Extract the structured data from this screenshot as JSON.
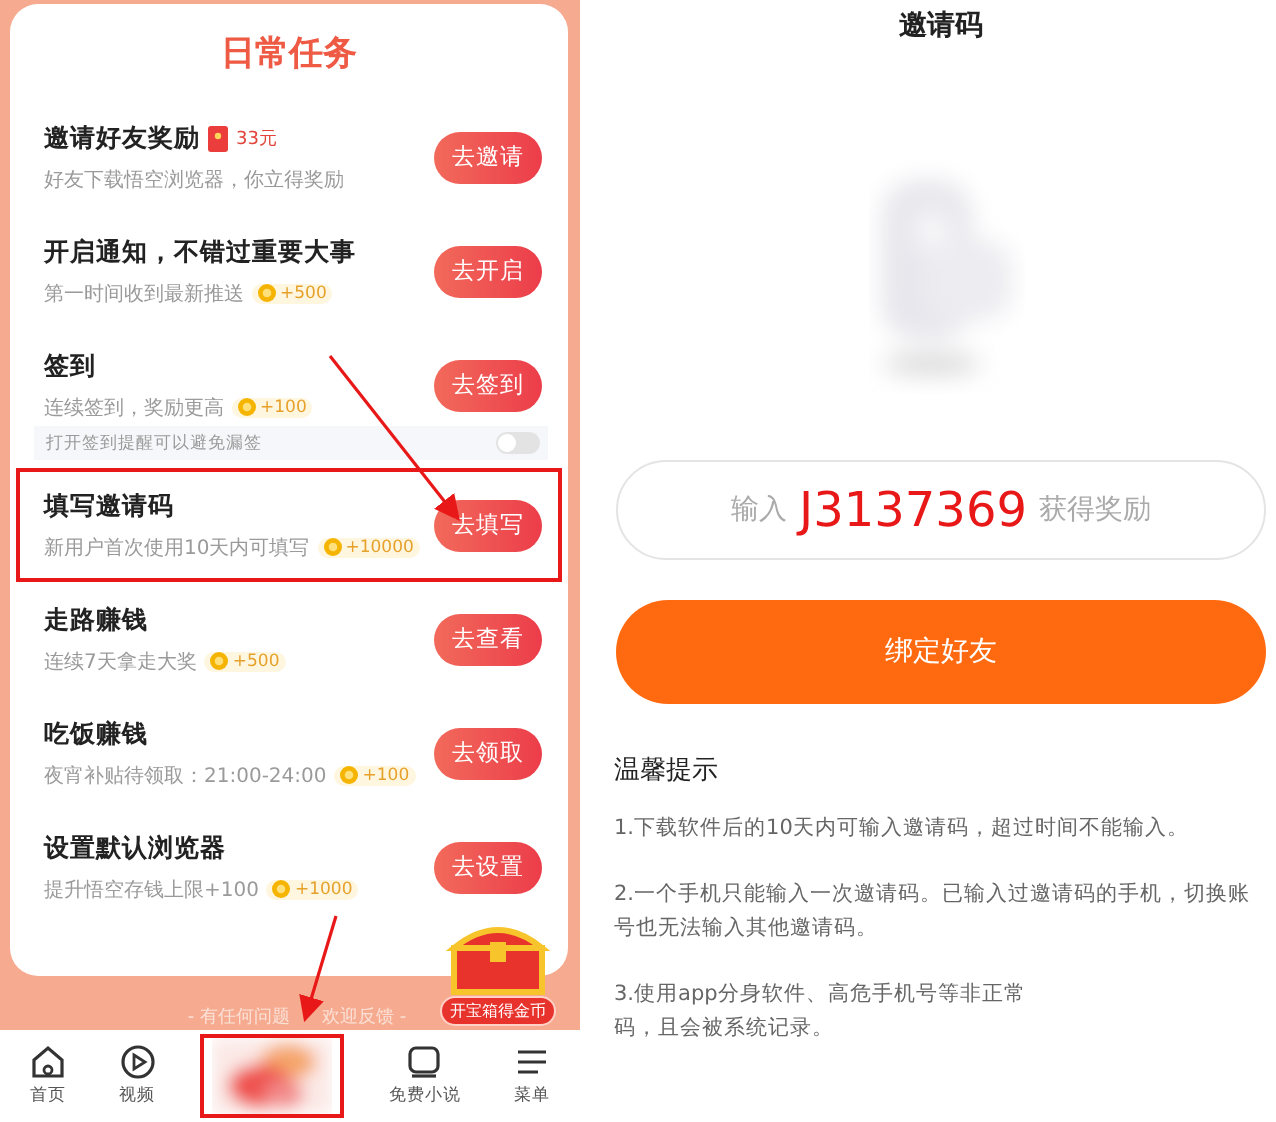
{
  "task_panel": {
    "title": "日常任务",
    "tasks": [
      {
        "title": "邀请好友奖励",
        "badge": {
          "kind": "cash",
          "text": "33元"
        },
        "subtitle": "好友下载悟空浏览器，你立得奖励",
        "button": "去邀请",
        "highlighted": false
      },
      {
        "title": "开启通知，不错过重要大事",
        "subtitle": "第一时间收到最新推送",
        "badge": {
          "kind": "coins",
          "text": "+500"
        },
        "button": "去开启",
        "highlighted": false
      },
      {
        "title": "签到",
        "subtitle": "连续签到，奖励更高",
        "badge": {
          "kind": "coins",
          "text": "+100"
        },
        "button": "去签到",
        "highlighted": false,
        "reminder": {
          "label": "打开签到提醒可以避免漏签",
          "on": false
        }
      },
      {
        "title": "填写邀请码",
        "subtitle": "新用户首次使用10天内可填写",
        "badge": {
          "kind": "coins",
          "text": "+10000"
        },
        "button": "去填写",
        "highlighted": true
      },
      {
        "title": "走路赚钱",
        "subtitle": "连续7天拿走大奖",
        "badge": {
          "kind": "coins",
          "text": "+500"
        },
        "button": "去查看",
        "highlighted": false
      },
      {
        "title": "吃饭赚钱",
        "subtitle": "夜宵补贴待领取：21:00-24:00",
        "badge": {
          "kind": "coins",
          "text": "+100"
        },
        "button": "去领取",
        "highlighted": false
      },
      {
        "title": "设置默认浏览器",
        "subtitle": "提升悟空存钱上限+100",
        "badge": {
          "kind": "coins",
          "text": "+1000"
        },
        "button": "去设置",
        "highlighted": false
      }
    ],
    "footer_parts": [
      "- 有任何问题",
      "欢迎反馈 -"
    ],
    "treasure_label": "开宝箱得金币"
  },
  "tab_bar": {
    "tabs": [
      {
        "kind": "home",
        "label": "首页",
        "highlighted": false
      },
      {
        "kind": "video",
        "label": "视频",
        "highlighted": false
      },
      {
        "kind": "picture",
        "highlighted": true
      },
      {
        "kind": "novel",
        "label": "免费小说",
        "highlighted": false
      },
      {
        "kind": "menu",
        "label": "菜单",
        "highlighted": false
      }
    ]
  },
  "invite_page": {
    "title": "邀请码",
    "placeholder_parts": [
      "输入",
      "获得奖励"
    ],
    "code_overlay": "J3137369",
    "button": "绑定好友",
    "tips_title": "温馨提示",
    "tips": [
      {
        "lines": [
          "1.下载软件后的10天内可输入邀请码，超过时间不能输入。"
        ]
      },
      {
        "lines": [
          "2.一个手机只能输入一次邀请码。已输入过邀请码的手机，切换账号也无法输入其他邀请码。"
        ]
      },
      {
        "lines": [
          "3.使用app分身软件、高危手机号等非正常",
          "码，且会被系统记录。"
        ]
      }
    ]
  }
}
